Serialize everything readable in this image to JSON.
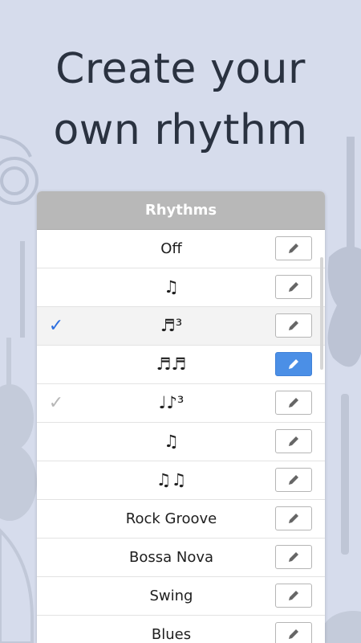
{
  "headline": {
    "line1": "Create your",
    "line2": "own rhythm"
  },
  "panel": {
    "title": "Rhythms",
    "edit_icon": "pencil-icon",
    "rows": [
      {
        "label": "Off",
        "check": "none",
        "edit_active": false
      },
      {
        "label": "♫",
        "check": "none",
        "edit_active": false
      },
      {
        "label": "♬³",
        "check": "blue",
        "edit_active": false
      },
      {
        "label": "♬♬",
        "check": "none",
        "edit_active": true
      },
      {
        "label": "♩♪³",
        "check": "gray",
        "edit_active": false
      },
      {
        "label": "♫",
        "check": "none",
        "edit_active": false
      },
      {
        "label": "♫♫",
        "check": "none",
        "edit_active": false
      },
      {
        "label": "Rock Groove",
        "check": "none",
        "edit_active": false
      },
      {
        "label": "Bossa Nova",
        "check": "none",
        "edit_active": false
      },
      {
        "label": "Swing",
        "check": "none",
        "edit_active": false
      },
      {
        "label": "Blues",
        "check": "none",
        "edit_active": false
      }
    ],
    "check_glyph": "✓"
  },
  "colors": {
    "background": "#d6dcec",
    "accent_blue": "#2d6fdf",
    "header_gray": "#b8b8b8"
  }
}
